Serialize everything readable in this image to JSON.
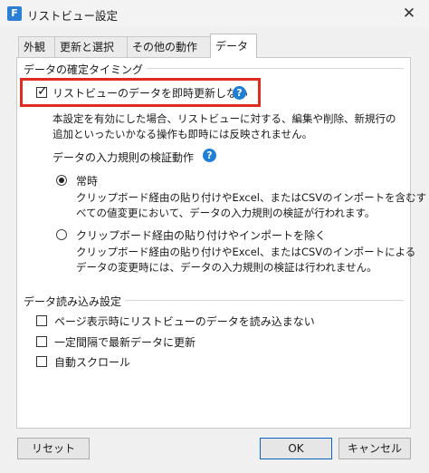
{
  "window": {
    "title": "リストビュー設定",
    "app_icon": "F"
  },
  "tabs": [
    "外観",
    "更新と選択",
    "その他の動作",
    "データ"
  ],
  "confirm_group": {
    "title": "データの確定タイミング",
    "checkbox_label": "リストビューのデータを即時更新しない",
    "checked": true,
    "description": [
      "本設定を有効にした場合、リストビューに対する、編集や削除、新規行の",
      "追加といったいかなる操作も即時には反映されません。"
    ],
    "validation_title": "データの入力規則の検証動作",
    "options": [
      {
        "label": "常時",
        "selected": true,
        "description": [
          "クリップボード経由の貼り付けやExcel、またはCSVのインポートを含むす",
          "べての値変更において、データの入力規則の検証が行われます。"
        ]
      },
      {
        "label": "クリップボード経由の貼り付けやインポートを除く",
        "selected": false,
        "description": [
          "クリップボード経由の貼り付けやExcel、またはCSVのインポートによる",
          "データの変更時には、データの入力規則の検証は行われません。"
        ]
      }
    ]
  },
  "load_group": {
    "title": "データ読み込み設定",
    "items": [
      {
        "label": "ページ表示時にリストビューのデータを読み込まない",
        "checked": false
      },
      {
        "label": "一定間隔で最新データに更新",
        "checked": false
      },
      {
        "label": "自動スクロール",
        "checked": false
      }
    ]
  },
  "buttons": {
    "reset": "リセット",
    "ok": "OK",
    "cancel": "キャンセル"
  },
  "colors": {
    "highlight": "#e02b20",
    "help": "#1f7fd6",
    "accent": "#0a64c8"
  }
}
